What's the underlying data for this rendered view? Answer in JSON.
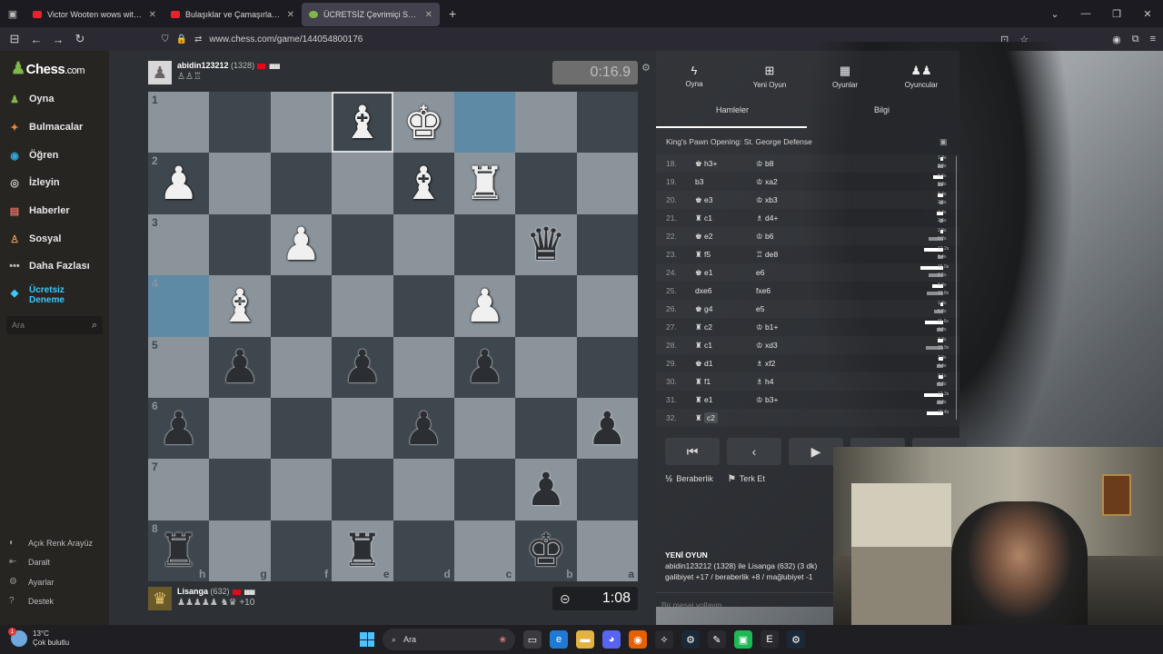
{
  "browser": {
    "tabs": [
      {
        "title": "Victor Wooten wows with his pe",
        "active": false
      },
      {
        "title": "Bulaşıklar ve Çamaşırlar Tek Ma",
        "active": false
      },
      {
        "title": "ÜCRETSİZ Çevrimiçi Satranç",
        "active": true
      }
    ],
    "url": "www.chess.com/game/144054800176"
  },
  "sidebar": {
    "logo": "Chess",
    "logo_suffix": ".com",
    "items": [
      {
        "label": "Oyna",
        "icon": "pawn-icon",
        "color": "#81b64c"
      },
      {
        "label": "Bulmacalar",
        "icon": "puzzle-icon",
        "color": "#f0883e"
      },
      {
        "label": "Öğren",
        "icon": "learn-icon",
        "color": "#2ea6d9"
      },
      {
        "label": "İzleyin",
        "icon": "binoculars-icon",
        "color": "#cccccc"
      },
      {
        "label": "Haberler",
        "icon": "news-icon",
        "color": "#e36b5b"
      },
      {
        "label": "Sosyal",
        "icon": "social-icon",
        "color": "#e0a050"
      },
      {
        "label": "Daha Fazlası",
        "icon": "more-icon",
        "color": "#bbbbbb"
      }
    ],
    "premium": {
      "line1": "Ücretsiz",
      "line2": "Deneme"
    },
    "search_placeholder": "Ara",
    "bottom": [
      {
        "label": "Açık Renk Arayüz",
        "icon": "contrast-icon"
      },
      {
        "label": "Daralt",
        "icon": "collapse-icon"
      },
      {
        "label": "Ayarlar",
        "icon": "settings-icon"
      },
      {
        "label": "Destek",
        "icon": "help-icon"
      }
    ]
  },
  "top_player": {
    "name": "abidin123212",
    "rating": "(1328)",
    "clock": "0:16.9"
  },
  "bottom_player": {
    "name": "Lisanga",
    "rating": "(632)",
    "clock": "1:08",
    "material": "+10"
  },
  "board": {
    "ranks": [
      "1",
      "2",
      "3",
      "4",
      "5",
      "6",
      "7",
      "8"
    ],
    "files": [
      "h",
      "g",
      "f",
      "e",
      "d",
      "c",
      "b",
      "a"
    ],
    "pieces": [
      [
        "",
        "",
        "",
        "wB",
        "wK",
        "",
        "",
        ""
      ],
      [
        "wP",
        "",
        "",
        "",
        "wB",
        "wR",
        "",
        ""
      ],
      [
        "",
        "",
        "wP",
        "",
        "",
        "",
        "bQ",
        ""
      ],
      [
        "",
        "wB",
        "",
        "",
        "",
        "wP",
        "",
        ""
      ],
      [
        "",
        "bP",
        "",
        "bP",
        "",
        "bP",
        "",
        ""
      ],
      [
        "bP",
        "",
        "",
        "",
        "bP",
        "",
        "",
        "bP"
      ],
      [
        "",
        "",
        "",
        "",
        "",
        "",
        "bP",
        ""
      ],
      [
        "bR",
        "",
        "",
        "bR",
        "",
        "",
        "bK",
        ""
      ]
    ]
  },
  "panel": {
    "tabs": [
      {
        "label": "Oyna",
        "icon": "lightning-icon"
      },
      {
        "label": "Yeni Oyun",
        "icon": "plus-icon"
      },
      {
        "label": "Oyunlar",
        "icon": "board-icon"
      },
      {
        "label": "Oyuncular",
        "icon": "players-icon"
      }
    ],
    "subtabs": [
      "Hamleler",
      "Bilgi"
    ],
    "opening": "King's Pawn Opening: St. George Defense",
    "moves": [
      {
        "n": "18.",
        "w": "h3+",
        "b": "b8",
        "t1": "1.8s",
        "t2": "3.3s"
      },
      {
        "n": "19.",
        "w": "b3",
        "b": "xa2",
        "t1": "6.6s",
        "t2": "3.3s"
      },
      {
        "n": "20.",
        "w": "e3",
        "b": "xb3",
        "t1": "3.4s",
        "t2": "2.5s"
      },
      {
        "n": "21.",
        "w": "c1",
        "b": "d4+",
        "t1": "4.4s",
        "t2": "2.6s"
      },
      {
        "n": "22.",
        "w": "e2",
        "b": "b6",
        "t1": "2.0s",
        "t2": "9.2s"
      },
      {
        "n": "23.",
        "w": "f5",
        "b": "de8",
        "t1": "12.2s",
        "t2": "3.4s"
      },
      {
        "n": "24.",
        "w": "e1",
        "b": "e6",
        "t1": "15.0s",
        "t2": "9.5s"
      },
      {
        "n": "25.",
        "w": "dxe6",
        "b": "fxe6",
        "t1": "6.9s",
        "t2": "10.8s"
      },
      {
        "n": "26.",
        "w": "g4",
        "b": "e5",
        "t1": "1.0s",
        "t2": "5.8s"
      },
      {
        "n": "27.",
        "w": "c2",
        "b": "b1+",
        "t1": "11.6s",
        "t2": "4.0s"
      },
      {
        "n": "28.",
        "w": "c1",
        "b": "xd3",
        "t1": "3.3s",
        "t2": "10.9s"
      },
      {
        "n": "29.",
        "w": "d1",
        "b": "xf2",
        "t1": "2.9s",
        "t2": "4.4s"
      },
      {
        "n": "30.",
        "w": "f1",
        "b": "h4",
        "t1": "3.1s",
        "t2": "4.3s"
      },
      {
        "n": "31.",
        "w": "e1",
        "b": "b3+",
        "t1": "12.3s",
        "t2": "3.9s"
      },
      {
        "n": "32.",
        "w": "c2",
        "b": "",
        "t1": "10.4s",
        "t2": ""
      }
    ],
    "draw_label": "Beraberlik",
    "resign_label": "Terk Et",
    "new_game_title": "YENİ OYUN",
    "new_game_line1": "abidin123212 (1328) ile Lisanga (632) (3 dk)",
    "new_game_line2": "galibiyet +17 / beraberlik +8 / mağlubiyet -1",
    "message_placeholder": "Bir mesaj yollayın..."
  },
  "taskbar": {
    "temp": "13°C",
    "weather": "Çok bulutlu",
    "badge": "1",
    "search": "Ara"
  }
}
